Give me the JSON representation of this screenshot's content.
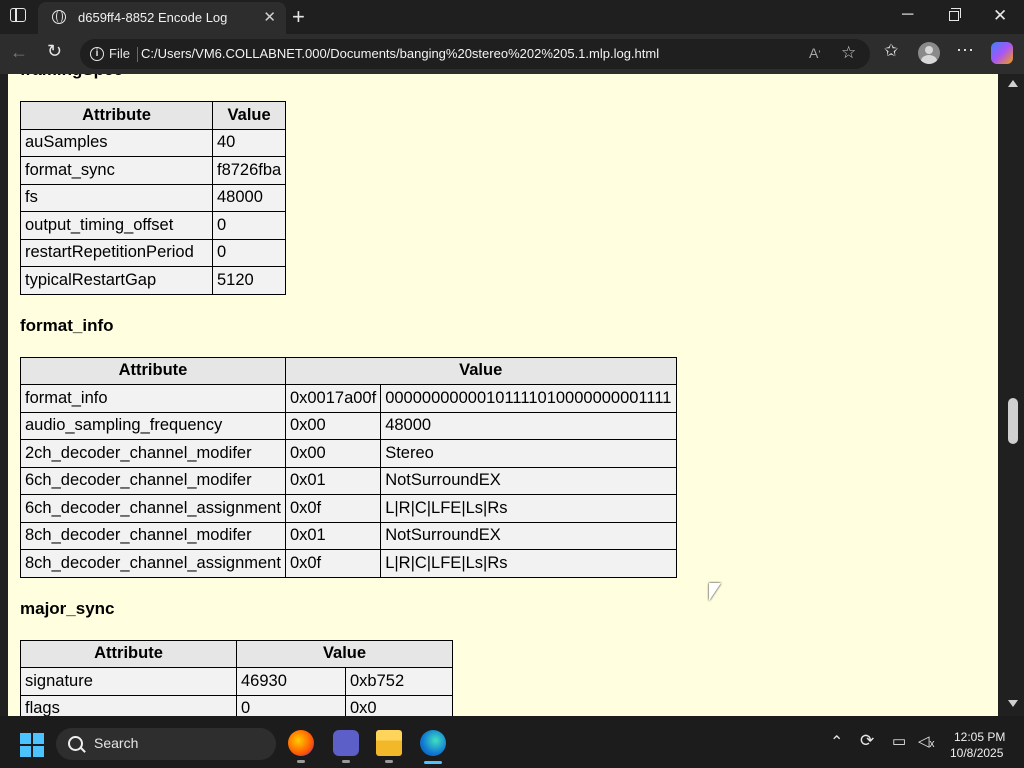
{
  "browser": {
    "tab_title": "d659ff4-8852 Encode Log",
    "address_label": "File",
    "url": "C:/Users/VM6.COLLABNET.000/Documents/banging%20stereo%202%205.1.mlp.log.html"
  },
  "document": {
    "sections": [
      {
        "heading": "framingSpec",
        "headers": [
          "Attribute",
          "Value"
        ],
        "rows": [
          [
            "auSamples",
            "40"
          ],
          [
            "format_sync",
            "f8726fba"
          ],
          [
            "fs",
            "48000"
          ],
          [
            "output_timing_offset",
            "0"
          ],
          [
            "restartRepetitionPeriod",
            "0"
          ],
          [
            "typicalRestartGap",
            "5120"
          ]
        ]
      },
      {
        "heading": "format_info",
        "headers": [
          "Attribute",
          "Value"
        ],
        "rows": [
          [
            "format_info",
            "0x0017a00f",
            "00000000000101111010000000001111"
          ],
          [
            "audio_sampling_frequency",
            "0x00",
            "48000"
          ],
          [
            "2ch_decoder_channel_modifer",
            "0x00",
            "Stereo"
          ],
          [
            "6ch_decoder_channel_modifer",
            "0x01",
            "NotSurroundEX"
          ],
          [
            "6ch_decoder_channel_assignment",
            "0x0f",
            "L|R|C|LFE|Ls|Rs"
          ],
          [
            "8ch_decoder_channel_modifer",
            "0x01",
            "NotSurroundEX"
          ],
          [
            "8ch_decoder_channel_assignment",
            "0x0f",
            "L|R|C|LFE|Ls|Rs"
          ]
        ]
      },
      {
        "heading": "major_sync",
        "headers": [
          "Attribute",
          "Value"
        ],
        "rows": [
          [
            "signature",
            "46930",
            "0xb752"
          ],
          [
            "flags",
            "0",
            "0x0"
          ]
        ]
      }
    ]
  },
  "taskbar": {
    "search_placeholder": "Search",
    "time": "12:05 PM",
    "date": "10/8/2025",
    "apps": [
      "firefox-icon",
      "teams-icon",
      "file-explorer-icon",
      "edge-icon"
    ]
  }
}
